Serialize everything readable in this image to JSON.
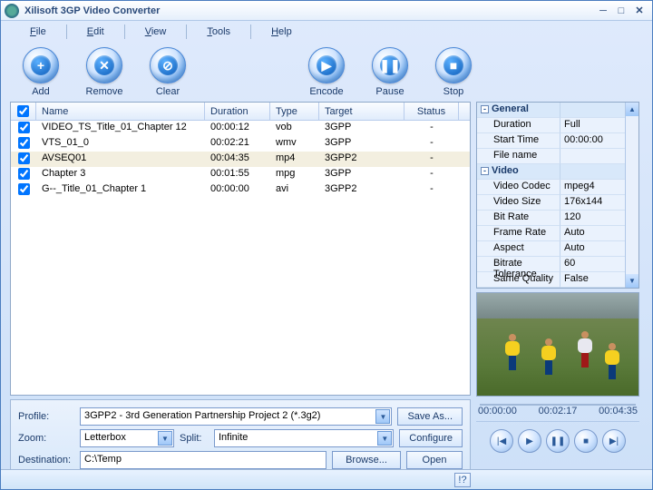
{
  "window": {
    "title": "Xilisoft 3GP Video Converter"
  },
  "menu": {
    "file": "File",
    "edit": "Edit",
    "view": "View",
    "tools": "Tools",
    "help": "Help"
  },
  "toolbar": {
    "add": "Add",
    "remove": "Remove",
    "clear": "Clear",
    "encode": "Encode",
    "pause": "Pause",
    "stop": "Stop"
  },
  "columns": {
    "name": "Name",
    "duration": "Duration",
    "type": "Type",
    "target": "Target",
    "status": "Status"
  },
  "rows": [
    {
      "name": "VIDEO_TS_Title_01_Chapter 12",
      "duration": "00:00:12",
      "type": "vob",
      "target": "3GPP",
      "status": "-"
    },
    {
      "name": "VTS_01_0",
      "duration": "00:02:21",
      "type": "wmv",
      "target": "3GPP",
      "status": "-"
    },
    {
      "name": "AVSEQ01",
      "duration": "00:04:35",
      "type": "mp4",
      "target": "3GPP2",
      "status": "-"
    },
    {
      "name": "Chapter 3",
      "duration": "00:01:55",
      "type": "mpg",
      "target": "3GPP",
      "status": "-"
    },
    {
      "name": "G--_Title_01_Chapter 1",
      "duration": "00:00:00",
      "type": "avi",
      "target": "3GPP2",
      "status": "-"
    }
  ],
  "opts": {
    "profile_lbl": "Profile:",
    "profile": "3GPP2 - 3rd Generation Partnership Project 2  (*.3g2)",
    "zoom_lbl": "Zoom:",
    "zoom": "Letterbox",
    "split_lbl": "Split:",
    "split": "Infinite",
    "dest_lbl": "Destination:",
    "dest": "C:\\Temp",
    "saveas": "Save As...",
    "configure": "Configure",
    "browse": "Browse...",
    "open": "Open"
  },
  "props": {
    "general_cat": "General",
    "duration_k": "Duration",
    "duration_v": "Full",
    "start_k": "Start Time",
    "start_v": "00:00:00",
    "file_k": "File name",
    "file_v": "",
    "video_cat": "Video",
    "codec_k": "Video Codec",
    "codec_v": "mpeg4",
    "size_k": "Video Size",
    "size_v": "176x144",
    "bitrate_k": "Bit Rate",
    "bitrate_v": "120",
    "fps_k": "Frame Rate",
    "fps_v": "Auto",
    "aspect_k": "Aspect",
    "aspect_v": "Auto",
    "tol_k": "Bitrate Tolerance",
    "tol_v": "60",
    "sq_k": "Same Quality",
    "sq_v": "False"
  },
  "timeline": {
    "t0": "00:00:00",
    "t1": "00:02:17",
    "t2": "00:04:35"
  }
}
